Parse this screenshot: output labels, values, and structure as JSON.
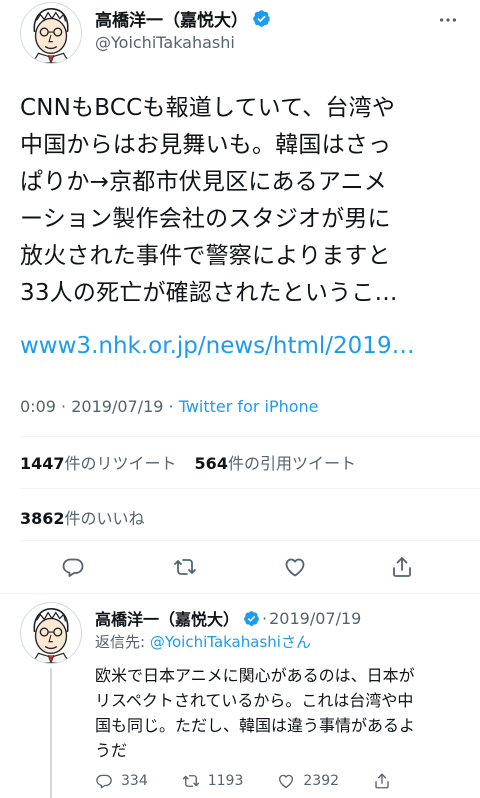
{
  "main_tweet": {
    "display_name": "高橋洋一（嘉悦大）",
    "handle": "@YoichiTakahashi",
    "text_lines": [
      "CNNもBCCも報道していて、台湾や",
      "中国からはお見舞いも。韓国はさっ",
      "ぱりか→京都市伏見区にあるアニメ",
      "ーション製作会社のスタジオが男に",
      "放火された事件で警察によりますと",
      "33人の死亡が確認されたというこ…"
    ],
    "link": "www3.nhk.or.jp/news/html/2019…",
    "time": "0:09",
    "date": "2019/07/19",
    "separator": "·",
    "source": "Twitter for iPhone"
  },
  "stats": {
    "retweets_count": "1447",
    "retweets_label": "件のリツイート",
    "quotes_count": "564",
    "quotes_label": "件の引用ツイート",
    "likes_count": "3862",
    "likes_label": "件のいいね"
  },
  "reply_tweet": {
    "display_name": "高橋洋一（嘉悦大）",
    "date": "2019/07/19",
    "dot": "·",
    "reply_prefix": "返信先: ",
    "reply_mention": "@YoichiTakahashi",
    "reply_suffix": "さん",
    "text_lines": [
      "欧米で日本アニメに関心があるのは、日本が",
      "リスペクトされているから。これは台湾や中",
      "国も同じ。ただし、韓国は違う事情があるよ",
      "うだ"
    ],
    "reply_count": "334",
    "retweet_count": "1193",
    "like_count": "2392"
  },
  "colors": {
    "accent": "#1d9bf0",
    "secondary_text": "#536471",
    "primary_text": "#0f1419"
  },
  "icons": {
    "verified": "verified-badge-icon",
    "more": "more-options-icon",
    "reply": "reply-icon",
    "retweet": "retweet-icon",
    "like": "heart-icon",
    "share": "share-icon"
  }
}
